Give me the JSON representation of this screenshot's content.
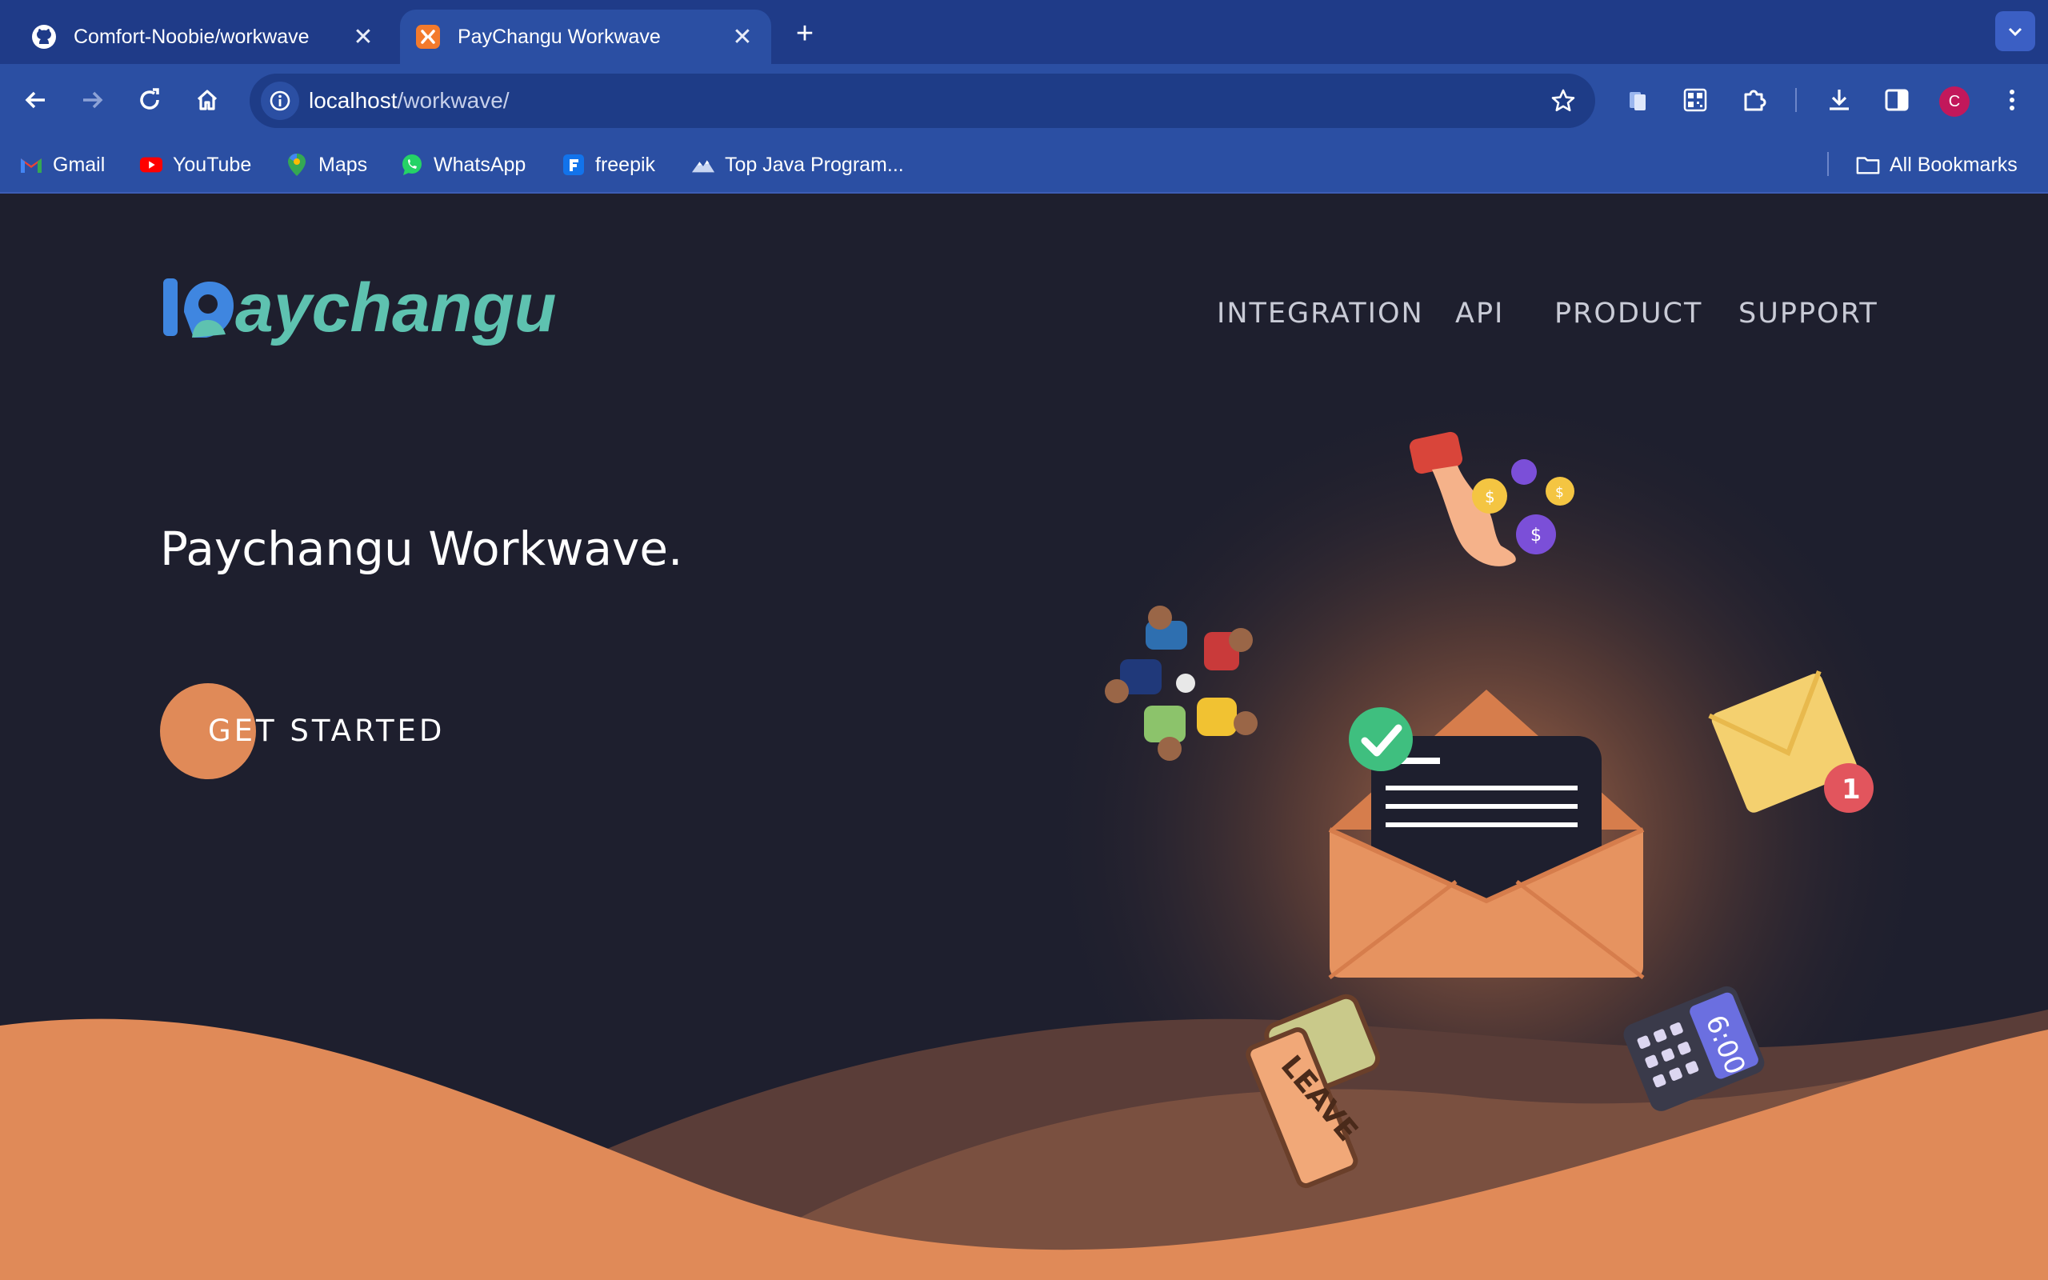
{
  "browser": {
    "tabs": [
      {
        "title": "Comfort-Noobie/workwave",
        "active": false,
        "icon": "github-icon"
      },
      {
        "title": "PayChangu Workwave",
        "active": true,
        "icon": "xampp-icon"
      }
    ],
    "url_host": "localhost",
    "url_path": "/workwave/",
    "profile_initial": "C",
    "bookmarks": [
      {
        "label": "Gmail",
        "icon": "gmail-icon"
      },
      {
        "label": "YouTube",
        "icon": "youtube-icon"
      },
      {
        "label": "Maps",
        "icon": "maps-icon"
      },
      {
        "label": "WhatsApp",
        "icon": "whatsapp-icon"
      },
      {
        "label": "freepik",
        "icon": "freepik-icon"
      },
      {
        "label": "Top Java Program...",
        "icon": "mountain-icon"
      }
    ],
    "all_bookmarks_label": "All Bookmarks"
  },
  "page": {
    "logo_text": "aychangu",
    "nav": [
      "INTEGRATION",
      "API",
      "PRODUCT",
      "SUPPORT"
    ],
    "hero_title": "Paychangu Workwave.",
    "cta_label": "GET STARTED",
    "illustration": {
      "leave_tag": "LEAVE",
      "calculator_display": "6:00",
      "notification_badge": "1"
    }
  },
  "colors": {
    "page_bg": "#1e1f2e",
    "accent_orange": "#e08a58",
    "logo_teal": "#5ec2b0",
    "logo_blue": "#3f86e0",
    "chrome_blue": "#2b4fa3"
  }
}
